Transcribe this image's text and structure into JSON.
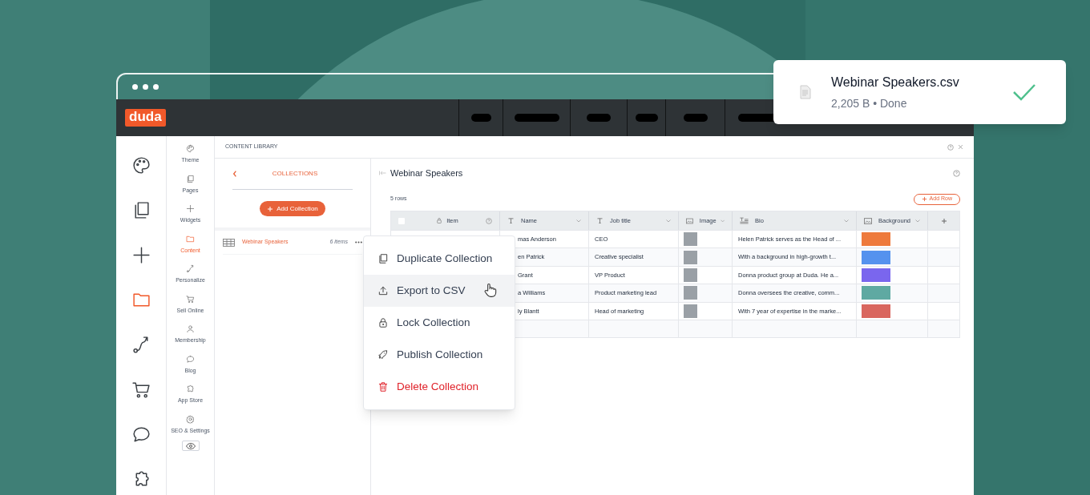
{
  "toast": {
    "filename": "Webinar Speakers.csv",
    "detail": "2,205 B • Done"
  },
  "window": {
    "logo": "duda"
  },
  "icon_rail": [
    {
      "kind": "palette",
      "selected": false
    },
    {
      "kind": "pages",
      "selected": false
    },
    {
      "kind": "plus",
      "selected": false
    },
    {
      "kind": "folder",
      "selected": true
    },
    {
      "kind": "route",
      "selected": false
    },
    {
      "kind": "cart",
      "selected": false
    },
    {
      "kind": "chat",
      "selected": false
    },
    {
      "kind": "puzzle",
      "selected": false
    }
  ],
  "nav": [
    {
      "label": "Theme",
      "kind": "palette",
      "selected": false
    },
    {
      "label": "Pages",
      "kind": "pages",
      "selected": false
    },
    {
      "label": "Widgets",
      "kind": "plus",
      "selected": false
    },
    {
      "label": "Content",
      "kind": "folder",
      "selected": true
    },
    {
      "label": "Personalize",
      "kind": "route",
      "selected": false
    },
    {
      "label": "Sell Online",
      "kind": "cart",
      "selected": false
    },
    {
      "label": "Membership",
      "kind": "person",
      "selected": false
    },
    {
      "label": "Blog",
      "kind": "chat",
      "selected": false
    },
    {
      "label": "App Store",
      "kind": "puzzle",
      "selected": false
    },
    {
      "label": "SEO & Settings",
      "kind": "gear",
      "selected": false
    }
  ],
  "panel": {
    "title": "CONTENT LIBRARY"
  },
  "collections": {
    "title": "COLLECTIONS",
    "add_button": "Add Collection",
    "items": [
      {
        "name": "Webinar Speakers",
        "count": "6 items",
        "selected": true
      }
    ]
  },
  "collection_view": {
    "title": "Webinar Speakers",
    "row_count": "5 rows",
    "add_row": "Add Row",
    "select_all": {
      "checked": false
    },
    "columns": [
      {
        "label": "Item",
        "kind": "item"
      },
      {
        "label": "Name",
        "kind": "text"
      },
      {
        "label": "Job title",
        "kind": "text"
      },
      {
        "label": "Image",
        "kind": "image"
      },
      {
        "label": "Bio",
        "kind": "richtext"
      },
      {
        "label": "Background",
        "kind": "image"
      }
    ],
    "rows": [
      {
        "name": "mas Anderson",
        "job_title": "CEO",
        "bio": "Helen Patrick serves as the Head of ...",
        "color": "#ee7a3c"
      },
      {
        "name": "en Patrick",
        "job_title": "Creative specialist",
        "bio": "With a background in high-growth t...",
        "color": "#5592ee"
      },
      {
        "name": "Grant",
        "job_title": "VP Product",
        "bio": "Donna product group at Duda. He a...",
        "color": "#7a66ee"
      },
      {
        "name": "a Williams",
        "job_title": "Product marketing lead",
        "bio": "Donna oversees the creative, comm...",
        "color": "#5fa9a2"
      },
      {
        "name": "ly Blantt",
        "job_title": "Head of marketing",
        "bio": "With 7 year of expertise in the marke...",
        "color": "#d9665e"
      }
    ]
  },
  "context_menu": [
    {
      "label": "Duplicate Collection",
      "kind": "duplicate",
      "selected": false
    },
    {
      "label": "Export to CSV",
      "kind": "export",
      "selected": true
    },
    {
      "label": "Lock Collection",
      "kind": "lock",
      "selected": false
    },
    {
      "label": "Publish Collection",
      "kind": "publish",
      "selected": false
    },
    {
      "label": "Delete Collection",
      "kind": "delete",
      "selected": false
    }
  ]
}
